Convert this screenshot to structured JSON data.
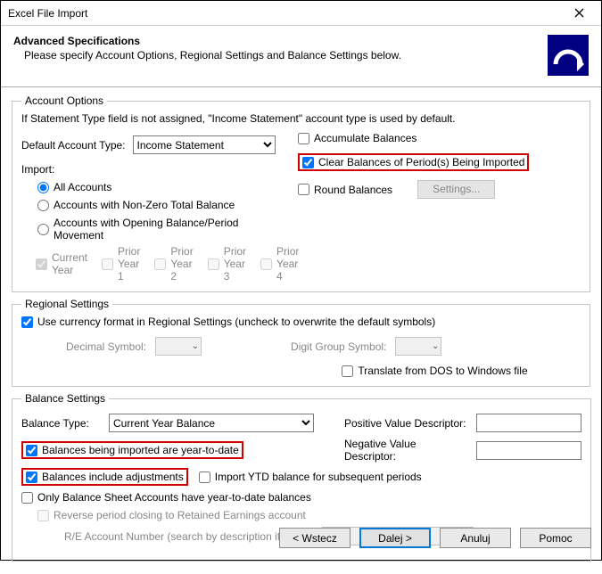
{
  "window": {
    "title": "Excel File Import"
  },
  "header": {
    "title": "Advanced Specifications",
    "subtitle": "Please specify Account Options, Regional Settings and Balance Settings below."
  },
  "account": {
    "legend": "Account Options",
    "note": "If Statement Type field is not assigned, \"Income Statement\" account type is used by default.",
    "default_type_label": "Default Account Type:",
    "default_type_value": "Income Statement",
    "import_label": "Import:",
    "radios": {
      "all": "All Accounts",
      "nonzero": "Accounts with Non-Zero Total Balance",
      "opening": "Accounts with Opening Balance/Period Movement"
    },
    "years": {
      "current": "Current Year",
      "p1": "Prior Year 1",
      "p2": "Prior Year 2",
      "p3": "Prior Year 3",
      "p4": "Prior Year 4"
    },
    "right": {
      "accumulate": "Accumulate Balances",
      "clear": "Clear Balances of Period(s) Being Imported",
      "round": "Round Balances",
      "settings_btn": "Settings..."
    }
  },
  "regional": {
    "legend": "Regional Settings",
    "currency_format": "Use currency format in Regional Settings (uncheck to overwrite the default symbols)",
    "decimal_label": "Decimal Symbol:",
    "digit_label": "Digit Group Symbol:",
    "translate": "Translate from DOS to Windows file"
  },
  "balance": {
    "legend": "Balance Settings",
    "type_label": "Balance Type:",
    "type_value": "Current Year Balance",
    "pos_label": "Positive Value Descriptor:",
    "neg_label": "Negative Value Descriptor:",
    "ytd": "Balances being imported are year-to-date",
    "adjustments": "Balances include adjustments",
    "import_ytd_subseq": "Import YTD balance for subsequent periods",
    "only_bs": "Only Balance Sheet Accounts have year-to-date balances",
    "reverse": "Reverse period closing to Retained Earnings account",
    "re_label": "R/E Account Number (search by description if blank):"
  },
  "footer": {
    "back": "< Wstecz",
    "next": "Dalej >",
    "cancel": "Anuluj",
    "help": "Pomoc"
  }
}
